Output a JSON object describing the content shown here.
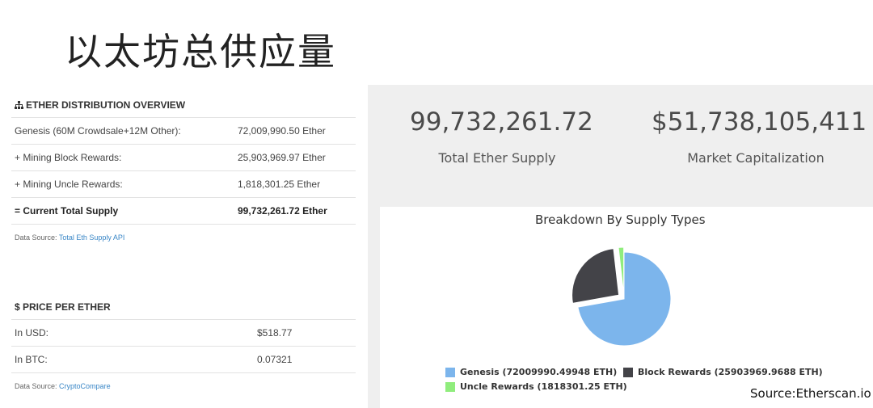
{
  "slide_title": "以太坊总供应量",
  "distribution": {
    "heading": "ETHER DISTRIBUTION OVERVIEW",
    "heading_icon": "sitemap-icon",
    "rows": [
      {
        "label": "Genesis (60M Crowdsale+12M Other):",
        "value": "72,009,990.50 Ether"
      },
      {
        "label": "+ Mining Block Rewards:",
        "value": "25,903,969.97 Ether"
      },
      {
        "label": "+ Mining Uncle Rewards:",
        "value": "1,818,301.25 Ether"
      },
      {
        "label": "= Current Total Supply",
        "value": "99,732,261.72 Ether"
      }
    ],
    "source_prefix": "Data Source:",
    "source_link": "Total Eth Supply API"
  },
  "price": {
    "heading": "$ PRICE PER ETHER",
    "rows": [
      {
        "label": "In USD:",
        "value": "$518.77"
      },
      {
        "label": "In BTC:",
        "value": "0.07321"
      }
    ],
    "source_prefix": "Data Source:",
    "source_link": "CryptoCompare"
  },
  "stats": {
    "total_supply_value": "99,732,261.72",
    "total_supply_label": "Total Ether Supply",
    "market_cap_value": "$51,738,105,411",
    "market_cap_label": "Market Capitalization"
  },
  "chart_data": {
    "type": "pie",
    "title": "Breakdown By Supply Types",
    "slices": [
      {
        "name": "Genesis",
        "value": 72009990.49948,
        "color": "#7cb5ec",
        "legend": "Genesis (72009990.49948 ETH)"
      },
      {
        "name": "Block Rewards",
        "value": 25903969.9688,
        "color": "#434348",
        "legend": "Block Rewards (25903969.9688 ETH)"
      },
      {
        "name": "Uncle Rewards",
        "value": 1818301.25,
        "color": "#90ed7d",
        "legend": "Uncle Rewards (1818301.25 ETH)"
      }
    ],
    "legend_position": "bottom"
  },
  "footer_source": "Source:Etherscan.io",
  "colors": {
    "link": "#3a87c7",
    "panel_bg": "#efefef"
  }
}
